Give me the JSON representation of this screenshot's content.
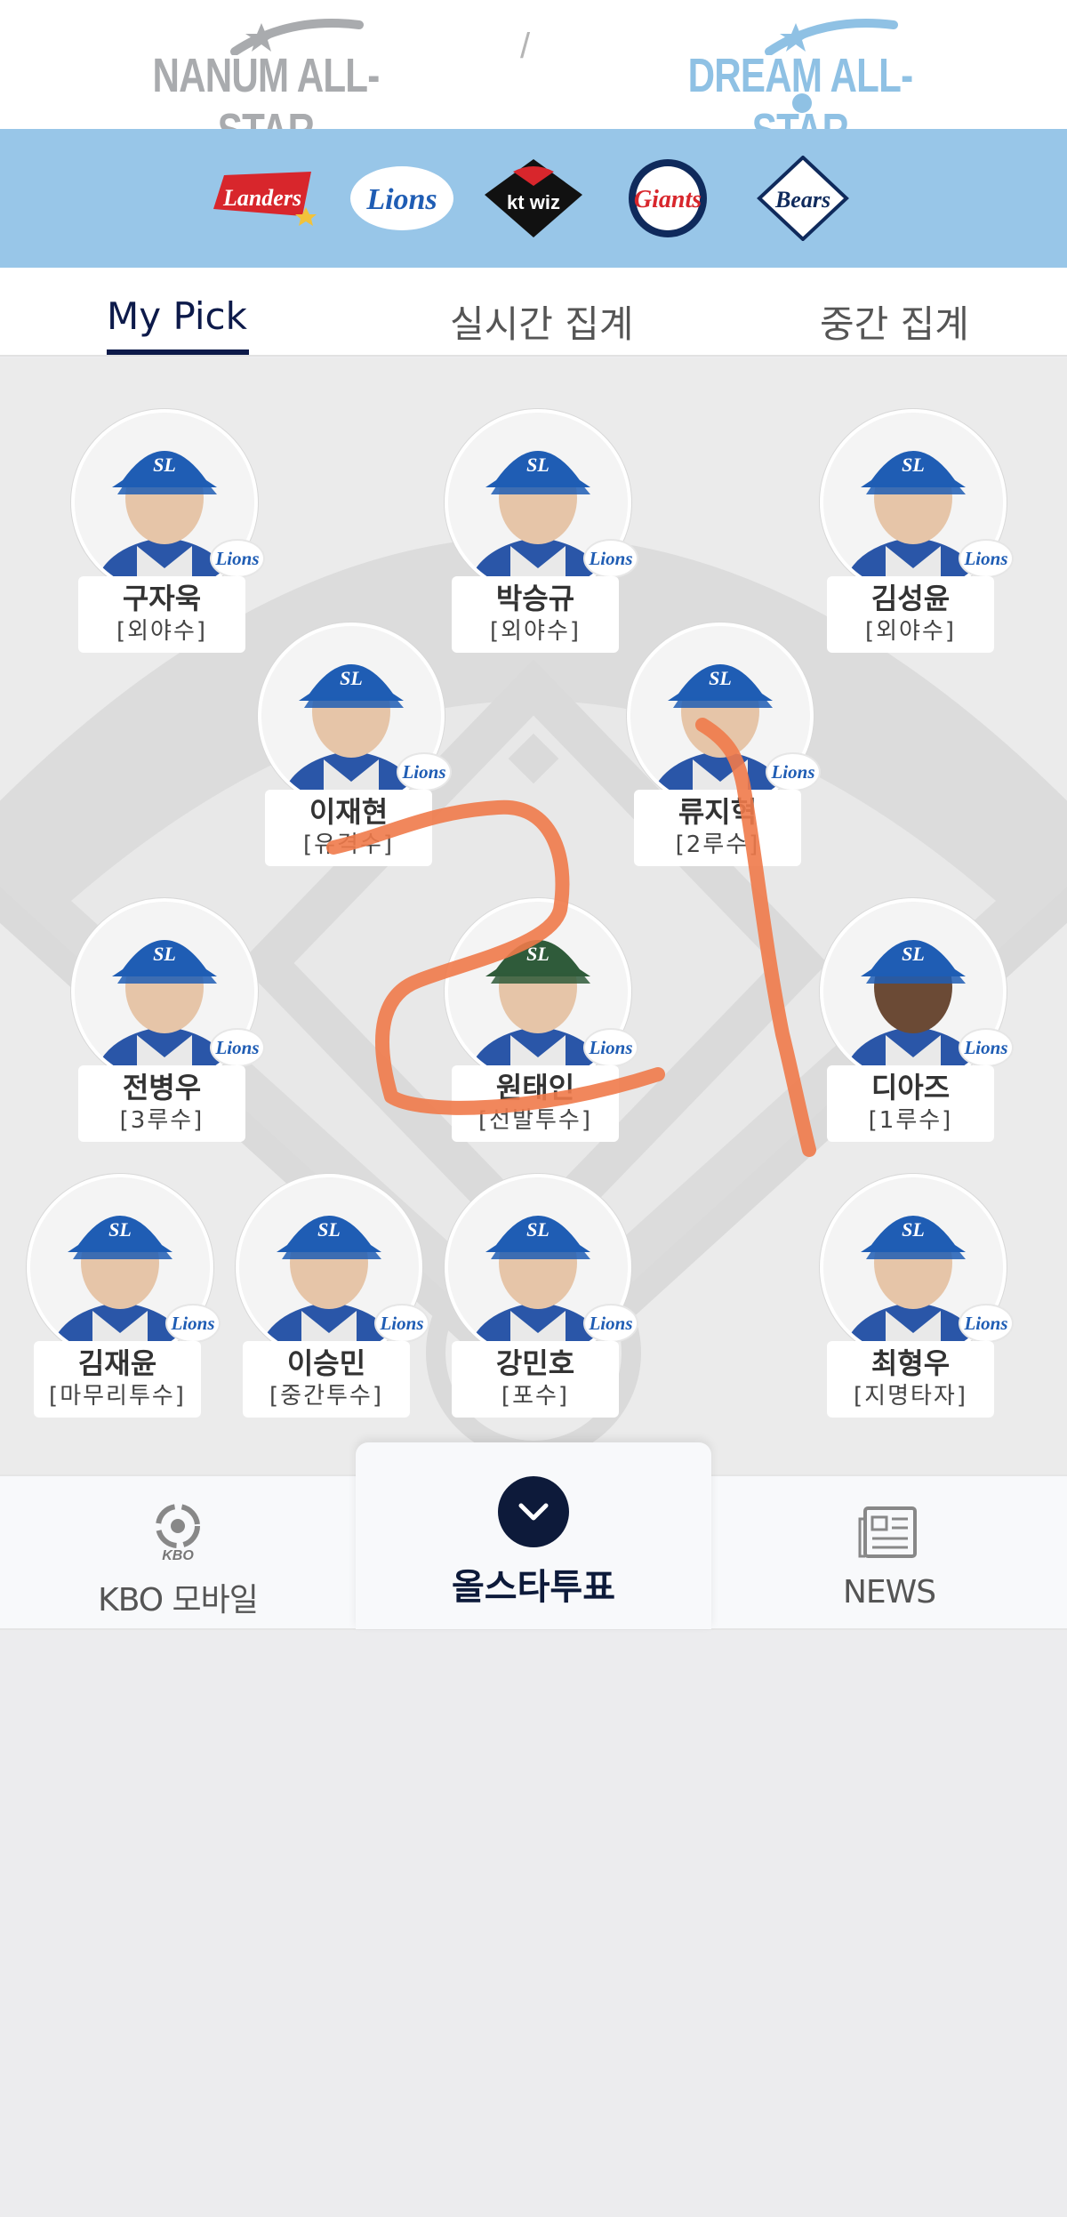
{
  "leagues": {
    "nanum": "NANUM ALL-STAR",
    "separator": "/",
    "dream": "DREAM ALL-STAR",
    "active": "dream"
  },
  "teams": [
    {
      "name": "Landers",
      "icon": "ssg-landers-logo"
    },
    {
      "name": "Lions",
      "icon": "samsung-lions-logo"
    },
    {
      "name": "kt wiz",
      "icon": "kt-wiz-logo"
    },
    {
      "name": "Giants",
      "icon": "lotte-giants-logo"
    },
    {
      "name": "Bears",
      "icon": "doosan-bears-logo"
    }
  ],
  "tabs": {
    "items": [
      "My Pick",
      "실시간 집계",
      "중간 집계"
    ],
    "active": "My Pick"
  },
  "badge_text": "Lions",
  "players": [
    {
      "name": "구자욱",
      "position": "[외야수]"
    },
    {
      "name": "박승규",
      "position": "[외야수]"
    },
    {
      "name": "김성윤",
      "position": "[외야수]"
    },
    {
      "name": "이재현",
      "position": "[유격수]"
    },
    {
      "name": "류지혁",
      "position": "[2루수]"
    },
    {
      "name": "전병우",
      "position": "[3루수]"
    },
    {
      "name": "원태인",
      "position": "[선발투수]"
    },
    {
      "name": "디아즈",
      "position": "[1루수]"
    },
    {
      "name": "김재윤",
      "position": "[마무리투수]"
    },
    {
      "name": "이승민",
      "position": "[중간투수]"
    },
    {
      "name": "강민호",
      "position": "[포수]"
    },
    {
      "name": "최형우",
      "position": "[지명타자]"
    }
  ],
  "bottom_nav": {
    "kbo_mobile": {
      "logo_text": "KBO",
      "label": "KBO 모바일"
    },
    "vote": {
      "label": "올스타투표",
      "icon": "chevron-down-icon"
    },
    "news": {
      "label": "NEWS",
      "icon": "newspaper-icon"
    }
  },
  "colors": {
    "team_strip": "#98c6e8",
    "dream_blue": "#8fc1e4",
    "navy": "#0d1a4a",
    "scribble": "#f07a4a"
  }
}
